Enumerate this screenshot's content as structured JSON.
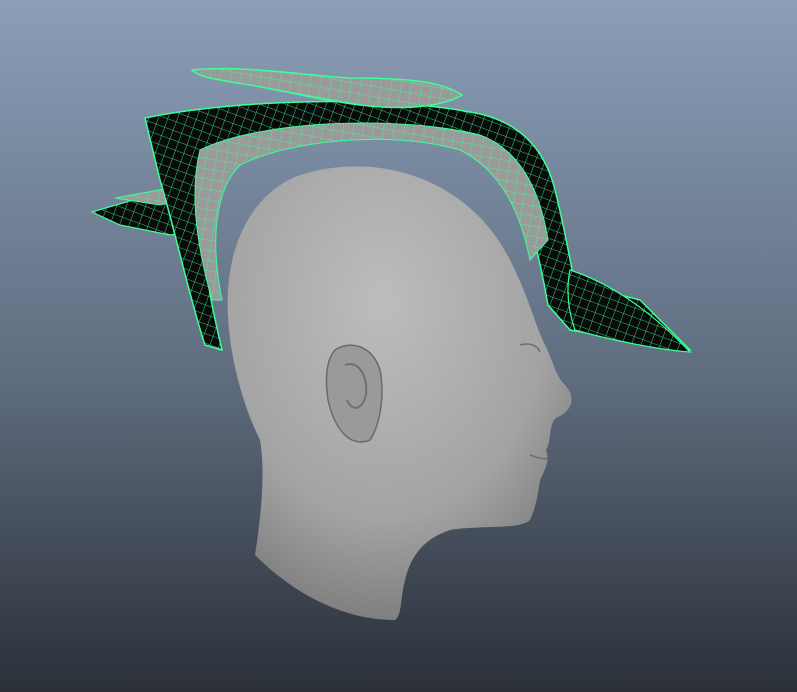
{
  "viewport": {
    "background_top": "#8b9fb8",
    "background_bottom": "#2b3038",
    "wireframe_color": "#3dff9a",
    "mesh_fill": "#0a0a0a",
    "head_color": "#a8a8a8",
    "objects": [
      "head-mesh",
      "hair-mesh"
    ]
  }
}
